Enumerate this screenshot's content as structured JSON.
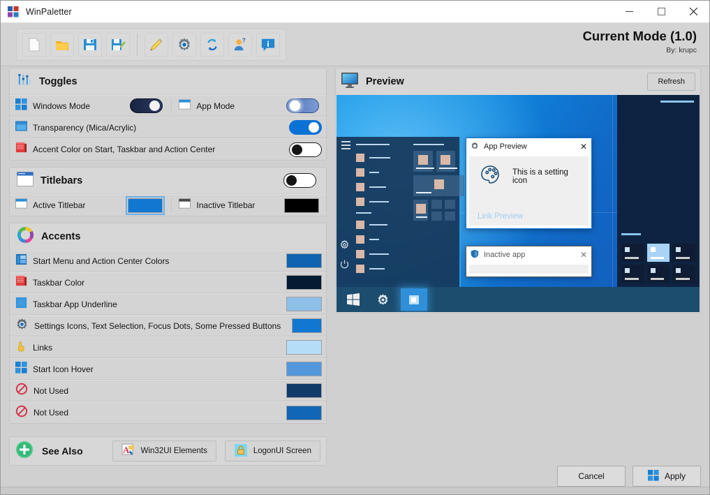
{
  "window": {
    "title": "WinPaletter",
    "icon": "winpaletter-logo-icon",
    "minimize": "–",
    "maximize": "▢",
    "close": "✕"
  },
  "toolbar": {
    "buttons": [
      {
        "name": "new-file-button",
        "icon": "new-document-icon",
        "tooltip": "New"
      },
      {
        "name": "open-file-button",
        "icon": "open-folder-icon",
        "tooltip": "Open"
      },
      {
        "name": "save-button",
        "icon": "save-floppy-icon",
        "tooltip": "Save"
      },
      {
        "name": "save-as-button",
        "icon": "save-as-floppy-icon",
        "tooltip": "Save As"
      },
      {
        "name": "edit-button",
        "icon": "pencil-icon",
        "tooltip": "Edit"
      },
      {
        "name": "settings-button",
        "icon": "gear-icon",
        "tooltip": "Settings"
      },
      {
        "name": "refresh-button",
        "icon": "sync-arrows-icon",
        "tooltip": "Refresh"
      },
      {
        "name": "account-button",
        "icon": "user-question-icon",
        "tooltip": "Account"
      },
      {
        "name": "info-button",
        "icon": "info-bubble-icon",
        "tooltip": "Info"
      }
    ],
    "mode_title": "Current Mode (1.0)",
    "mode_by": "By: krupc"
  },
  "toggles_group": {
    "icon": "sliders-icon",
    "title": "Toggles",
    "rows": [
      {
        "left": {
          "name": "windows-mode",
          "icon": "windows-logo-icon",
          "label": "Windows Mode",
          "toggle": "dark"
        },
        "right": {
          "name": "app-mode",
          "icon": "app-window-icon",
          "label": "App Mode",
          "toggle": "light"
        }
      },
      {
        "left": {
          "name": "transparency",
          "icon": "transparency-window-icon",
          "label": "Transparency (Mica/Acrylic)",
          "toggle": "on"
        }
      },
      {
        "left": {
          "name": "accent-color-on-surfaces",
          "icon": "taskbar-red-icon",
          "label": "Accent Color on Start, Taskbar and Action Center",
          "toggle": "off"
        }
      }
    ]
  },
  "titlebars_group": {
    "icon": "titlebar-window-icon",
    "title": "Titlebars",
    "toggle": "off",
    "rows": [
      {
        "name": "active-titlebar",
        "icon": "active-titlebar-icon",
        "label": "Active Titlebar",
        "color": "#1177d1",
        "selected": true
      },
      {
        "name": "inactive-titlebar",
        "icon": "inactive-titlebar-icon",
        "label": "Inactive Titlebar",
        "color": "#000000",
        "selected": false
      }
    ]
  },
  "accents_group": {
    "icon": "color-wheel-icon",
    "title": "Accents",
    "rows": [
      {
        "name": "start-menu-action-center-colors",
        "icon": "start-menu-icon",
        "label": "Start Menu and Action Center Colors",
        "color": "#0f63b0"
      },
      {
        "name": "taskbar-color",
        "icon": "taskbar-red-icon",
        "label": "Taskbar Color",
        "color": "#061a33"
      },
      {
        "name": "taskbar-app-underline",
        "icon": "blue-square-icon",
        "label": "Taskbar App Underline",
        "color": "#8ebfe7"
      },
      {
        "name": "settings-icons-text-selection",
        "icon": "gear-icon",
        "label": "Settings Icons, Text Selection, Focus Dots, Some Pressed Buttons",
        "color": "#1177d1"
      },
      {
        "name": "links",
        "icon": "pointing-hand-icon",
        "label": "Links",
        "color": "#b6ddf8"
      },
      {
        "name": "start-icon-hover",
        "icon": "windows-logo-icon",
        "label": "Start Icon Hover",
        "color": "#5297dc"
      },
      {
        "name": "not-used-1",
        "icon": "blocked-icon",
        "label": "Not Used",
        "color": "#103a68"
      },
      {
        "name": "not-used-2",
        "icon": "blocked-icon",
        "label": "Not Used",
        "color": "#1266b6"
      }
    ]
  },
  "see_also": {
    "icon": "plus-circle-icon",
    "title": "See Also",
    "buttons": [
      {
        "name": "win32ui-elements-button",
        "icon": "win32ui-letter-a-icon",
        "label": "Win32UI Elements"
      },
      {
        "name": "logonui-screen-button",
        "icon": "lock-icon",
        "label": "LogonUI Screen"
      }
    ]
  },
  "preview": {
    "icon": "monitor-icon",
    "title": "Preview",
    "refresh_label": "Refresh",
    "app_window": {
      "icon": "gear-icon",
      "title": "App Preview",
      "close": "✕",
      "setting_icon": "palette-icon",
      "setting_text": "This is a setting icon",
      "link_text": "Link Preview"
    },
    "inactive_window": {
      "icon": "shield-icon",
      "title": "Inactive app",
      "close": "✕"
    }
  },
  "footer": {
    "cancel_label": "Cancel",
    "apply_label": "Apply",
    "apply_icon": "windows-logo-icon"
  }
}
